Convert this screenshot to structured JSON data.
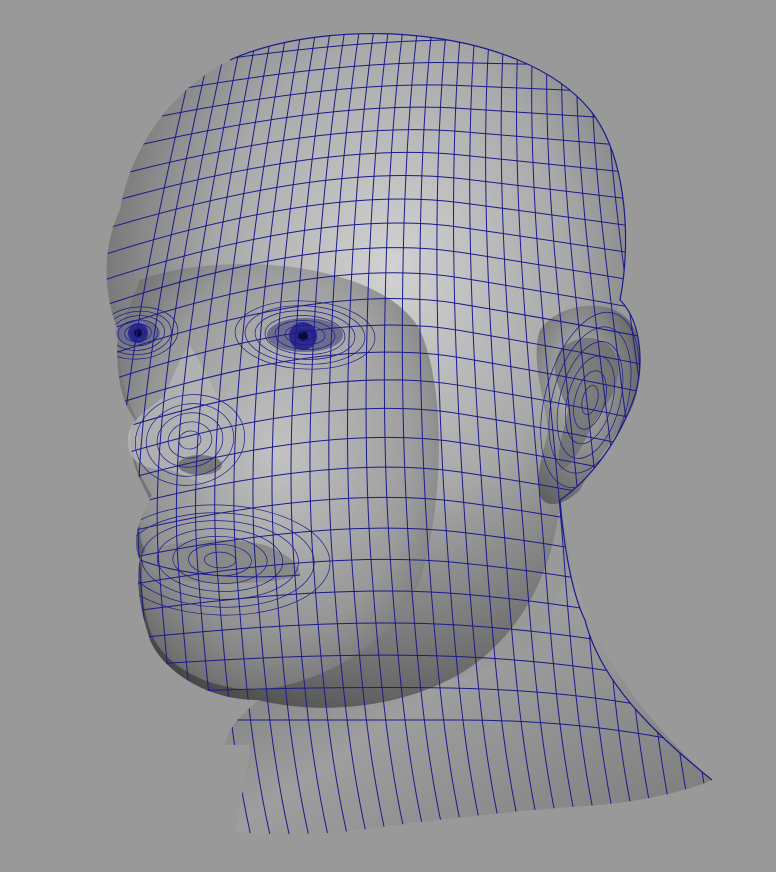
{
  "viewport": {
    "background_color": "#999999",
    "wireframe_color": "#1a1a8c",
    "mesh_shade_light": "#c9c9c9",
    "mesh_shade_mid": "#8f8f8f",
    "mesh_shade_dark": "#4a4a4a",
    "subject": "polygon-mesh-head-model"
  }
}
